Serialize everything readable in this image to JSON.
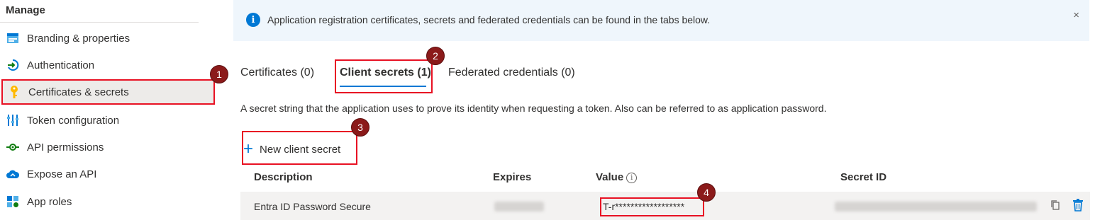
{
  "sidebar": {
    "header": "Manage",
    "items": [
      {
        "label": "Branding & properties",
        "icon": "branding-icon"
      },
      {
        "label": "Authentication",
        "icon": "authentication-icon"
      },
      {
        "label": "Certificates & secrets",
        "icon": "key-icon"
      },
      {
        "label": "Token configuration",
        "icon": "token-config-icon"
      },
      {
        "label": "API permissions",
        "icon": "api-permissions-icon"
      },
      {
        "label": "Expose an API",
        "icon": "cloud-icon"
      },
      {
        "label": "App roles",
        "icon": "app-roles-icon"
      }
    ],
    "active_index": 2
  },
  "banner": {
    "text": "Application registration certificates, secrets and federated credentials can be found in the tabs below.",
    "close": "×"
  },
  "tabs": [
    {
      "label": "Certificates (0)"
    },
    {
      "label": "Client secrets (1)"
    },
    {
      "label": "Federated credentials (0)"
    }
  ],
  "selected_tab": 1,
  "description": "A secret string that the application uses to prove its identity when requesting a token. Also can be referred to as application password.",
  "new_button": {
    "label": "New client secret"
  },
  "table": {
    "headers": {
      "description": "Description",
      "expires": "Expires",
      "value": "Value",
      "secret_id": "Secret ID"
    },
    "rows": [
      {
        "description": "Entra ID Password Secure",
        "value": "T-r******************"
      }
    ]
  },
  "badges": [
    "1",
    "2",
    "3",
    "4"
  ],
  "colors": {
    "accent": "#0078d4",
    "highlight": "#e81123",
    "badge": "#8b1a1a",
    "banner_bg": "#eff6fc"
  }
}
